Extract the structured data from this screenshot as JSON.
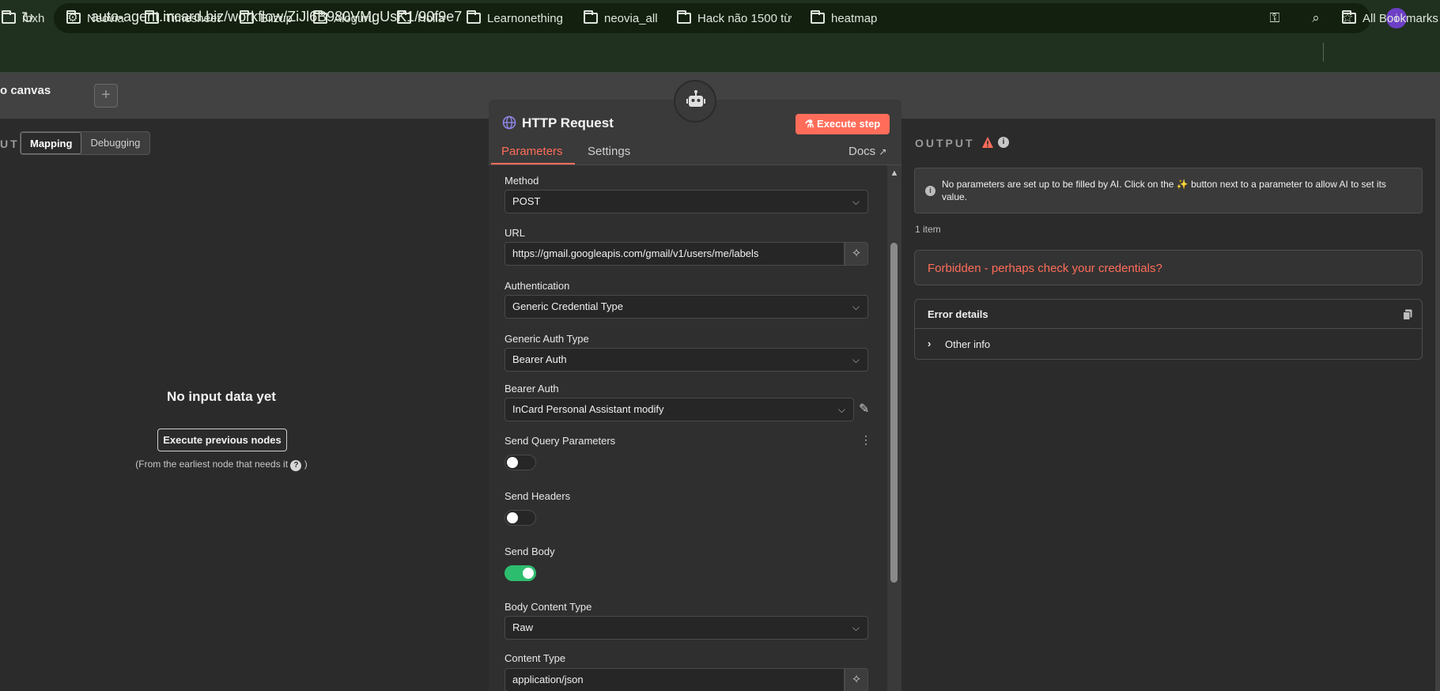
{
  "browser": {
    "url": "auto-agent.incard.biz/workflow/ZiJl6B980VMgUsK1/90f9e7",
    "profile_initial": "i",
    "bookmarks": [
      {
        "label": "mxh"
      },
      {
        "label": "Neovia"
      },
      {
        "label": "Timesheet"
      },
      {
        "label": "Biizup"
      },
      {
        "label": "Aloguru"
      },
      {
        "label": "Holla"
      },
      {
        "label": "Learnonething"
      },
      {
        "label": "neovia_all"
      },
      {
        "label": "Hack não 1500 từ"
      },
      {
        "label": "heatmap"
      }
    ],
    "all_bookmarks": "All Bookmarks"
  },
  "header": {
    "back_label": "o canvas",
    "add_symbol": "+"
  },
  "input_panel": {
    "title": "UT",
    "mode_tabs": [
      "Mapping",
      "Debugging"
    ],
    "empty_title": "No input data yet",
    "execute_previous": "Execute previous nodes",
    "hint": "(From the earliest node that needs it",
    "hint_end": ")"
  },
  "node": {
    "title": "HTTP Request",
    "execute_step": "Execute step",
    "tabs": [
      "Parameters",
      "Settings"
    ],
    "docs": "Docs",
    "params": {
      "method_label": "Method",
      "method_value": "POST",
      "url_label": "URL",
      "url_value": "https://gmail.googleapis.com/gmail/v1/users/me/labels",
      "auth_label": "Authentication",
      "auth_value": "Generic Credential Type",
      "generic_auth_label": "Generic Auth Type",
      "generic_auth_value": "Bearer Auth",
      "bearer_label": "Bearer Auth",
      "bearer_value": "InCard Personal Assistant modify",
      "send_query_label": "Send Query Parameters",
      "send_query_on": false,
      "send_headers_label": "Send Headers",
      "send_headers_on": false,
      "send_body_label": "Send Body",
      "send_body_on": true,
      "body_type_label": "Body Content Type",
      "body_type_value": "Raw",
      "content_type_label": "Content Type",
      "content_type_value": "application/json"
    }
  },
  "output_panel": {
    "title": "OUTPUT",
    "notice": "No parameters are set up to be filled by AI. Click on the ✨ button next to a parameter to allow AI to set its value.",
    "items_count": "1 item",
    "error": "Forbidden - perhaps check your credentials?",
    "details_title": "Error details",
    "other_info": "Other info"
  },
  "colors": {
    "accent": "#ff6d5a",
    "toggle_on": "#2dbd6e",
    "browser_bg": "#20311f"
  }
}
